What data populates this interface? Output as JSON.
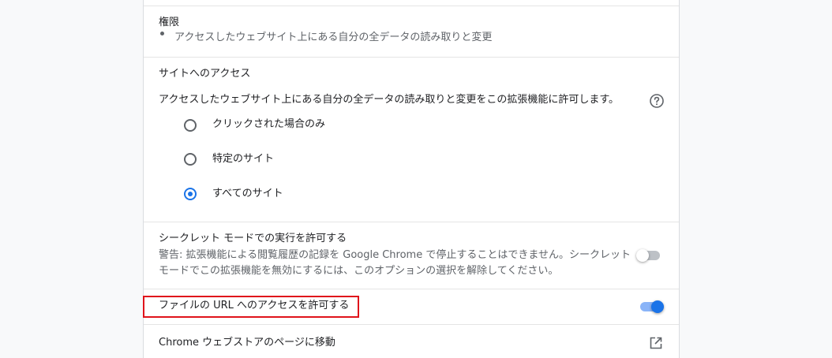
{
  "permissions": {
    "heading": "権限",
    "items": [
      "アクセスしたウェブサイト上にある自分の全データの読み取りと変更"
    ]
  },
  "site_access": {
    "heading": "サイトへのアクセス",
    "description": "アクセスしたウェブサイト上にある自分の全データの読み取りと変更をこの拡張機能に許可します。",
    "help_icon": "help-circle-icon",
    "options": [
      {
        "label": "クリックされた場合のみ",
        "selected": false
      },
      {
        "label": "特定のサイト",
        "selected": false
      },
      {
        "label": "すべてのサイト",
        "selected": true
      }
    ]
  },
  "incognito": {
    "title": "シークレット モードでの実行を許可する",
    "warning_line1": "警告: 拡張機能による閲覧履歴の記録を Google Chrome で停止することはできません。シークレット",
    "warning_line2": "モードでこの拡張機能を無効にするには、このオプションの選択を解除してください。",
    "enabled": false
  },
  "file_urls": {
    "label": "ファイルの URL へのアクセスを許可する",
    "enabled": true
  },
  "webstore": {
    "label": "Chrome ウェブストアのページに移動",
    "icon": "open-in-new-icon"
  },
  "colors": {
    "accent": "#1a73e8",
    "highlight": "#e0131b"
  }
}
